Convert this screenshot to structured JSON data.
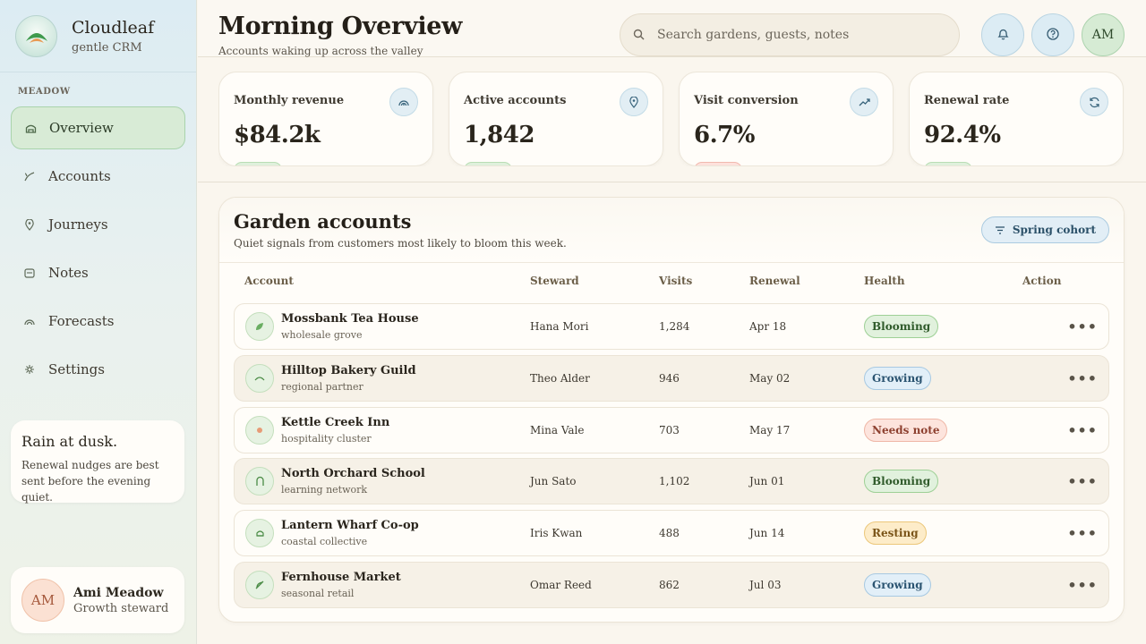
{
  "brand": {
    "name": "Cloudleaf",
    "subtitle": "gentle CRM"
  },
  "sidebar": {
    "section_label": "MEADOW",
    "items": [
      {
        "label": "Overview",
        "icon": "home-icon",
        "active": true
      },
      {
        "label": "Accounts",
        "icon": "sprout-icon"
      },
      {
        "label": "Journeys",
        "icon": "map-pin-icon"
      },
      {
        "label": "Notes",
        "icon": "note-icon"
      },
      {
        "label": "Forecasts",
        "icon": "rainbow-icon"
      },
      {
        "label": "Settings",
        "icon": "gear-icon"
      }
    ],
    "tip": {
      "title": "Rain at dusk.",
      "body": "Renewal nudges are best sent before the evening quiet."
    },
    "user": {
      "initials": "AM",
      "name": "Ami Meadow",
      "role": "Growth steward"
    }
  },
  "header": {
    "title": "Morning Overview",
    "subtitle": "Accounts waking up across the valley",
    "search_placeholder": "Search gardens, guests, notes",
    "avatar_initials": "AM"
  },
  "kpis": [
    {
      "label": "Monthly revenue",
      "value": "$84.2k",
      "icon": "rainbow-icon",
      "trend": "good"
    },
    {
      "label": "Active accounts",
      "value": "1,842",
      "icon": "map-pin-icon",
      "trend": "good"
    },
    {
      "label": "Visit conversion",
      "value": "6.7%",
      "icon": "trend-up-icon",
      "trend": "bad"
    },
    {
      "label": "Renewal rate",
      "value": "92.4%",
      "icon": "refresh-icon",
      "trend": "good"
    }
  ],
  "panel": {
    "title": "Garden accounts",
    "subtitle": "Quiet signals from customers most likely to bloom this week.",
    "filter_label": "Spring cohort",
    "columns": [
      "Account",
      "Steward",
      "Visits",
      "Renewal",
      "Health",
      "Action"
    ],
    "rows": [
      {
        "name": "Mossbank Tea House",
        "sub": "wholesale grove",
        "steward": "Hana Mori",
        "visits": "1,284",
        "renewal": "Apr 18",
        "health": "Blooming",
        "icon": "leaf-icon"
      },
      {
        "name": "Hilltop Bakery Guild",
        "sub": "regional partner",
        "steward": "Theo Alder",
        "visits": "946",
        "renewal": "May 02",
        "health": "Growing",
        "icon": "hill-icon"
      },
      {
        "name": "Kettle Creek Inn",
        "sub": "hospitality cluster",
        "steward": "Mina Vale",
        "visits": "703",
        "renewal": "May 17",
        "health": "Needs note",
        "icon": "dot-icon"
      },
      {
        "name": "North Orchard School",
        "sub": "learning network",
        "steward": "Jun Sato",
        "visits": "1,102",
        "renewal": "Jun 01",
        "health": "Blooming",
        "icon": "arch-icon"
      },
      {
        "name": "Lantern Wharf Co-op",
        "sub": "coastal collective",
        "steward": "Iris Kwan",
        "visits": "488",
        "renewal": "Jun 14",
        "health": "Resting",
        "icon": "lantern-icon"
      },
      {
        "name": "Fernhouse Market",
        "sub": "seasonal retail",
        "steward": "Omar Reed",
        "visits": "862",
        "renewal": "Jul 03",
        "health": "Growing",
        "icon": "leaf-icon"
      }
    ],
    "more_label": "•••"
  }
}
